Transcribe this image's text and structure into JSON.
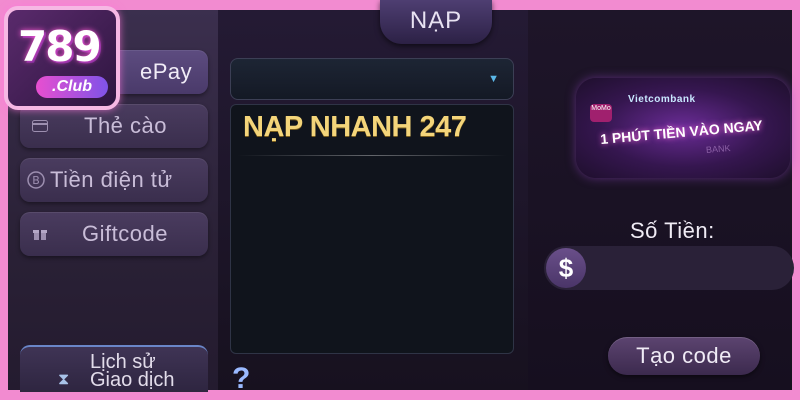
{
  "logo": {
    "number": "789",
    "club": ".Club"
  },
  "sidebar": {
    "items": [
      {
        "label": "ePay",
        "icon": "wallet-icon"
      },
      {
        "label": "Thẻ cào",
        "icon": "card-icon"
      },
      {
        "label": "Tiền điện tử",
        "icon": "bitcoin-icon"
      },
      {
        "label": "Giftcode",
        "icon": "gift-icon"
      }
    ],
    "history": {
      "label_line1": "Lịch sử",
      "label_line2": "Giao dịch",
      "icon": "hourglass-icon"
    }
  },
  "header": {
    "tab": "NẠP"
  },
  "method": {
    "dropdown_value": "",
    "list": [
      "NẠP NHANH 247"
    ],
    "help": "?"
  },
  "banner": {
    "bank": "Vietcombank",
    "wallet": "MoMo",
    "slogan": "1 PHÚT TIỀN VÀO NGAY",
    "tag": "BANK"
  },
  "amount": {
    "label": "Số Tiền:",
    "currency_symbol": "$",
    "value": ""
  },
  "actions": {
    "create_code": "Tạo code"
  },
  "colors": {
    "frame": "#f28bd0",
    "gold_text": "#f4d57a",
    "accent_blue": "#5bb8e8"
  }
}
